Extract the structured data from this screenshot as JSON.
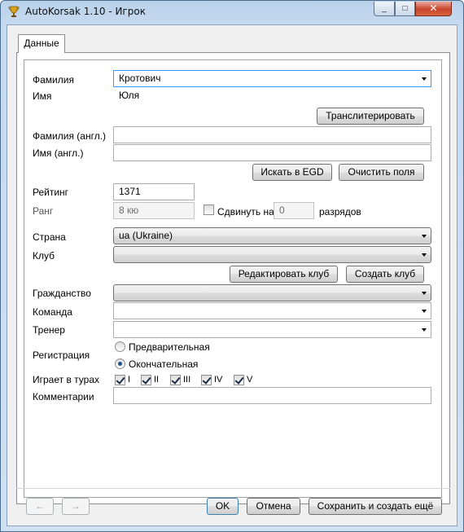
{
  "window": {
    "title": "AutoKorsak 1.10 - Игрок",
    "minimize_glyph": "_",
    "maximize_glyph": "□",
    "close_glyph": "✕",
    "icon": "trophy-icon"
  },
  "tabs": [
    {
      "label": "Данные",
      "active": true
    }
  ],
  "form": {
    "surname": {
      "label": "Фамилия",
      "value": "Кротович"
    },
    "name": {
      "label": "Имя",
      "value": "Юля"
    },
    "transliterate_button": "Транслитерировать",
    "surname_en": {
      "label": "Фамилия (англ.)",
      "value": ""
    },
    "name_en": {
      "label": "Имя (англ.)",
      "value": ""
    },
    "search_egd_button": "Искать в EGD",
    "clear_fields_button": "Очистить поля",
    "rating": {
      "label": "Рейтинг",
      "value": "1371"
    },
    "rank": {
      "label": "Ранг",
      "value": "8 кю"
    },
    "shift": {
      "label": "Сдвинуть на",
      "value": "0",
      "suffix": "разрядов",
      "checked": false
    },
    "country": {
      "label": "Страна",
      "value": "ua (Ukraine)"
    },
    "club": {
      "label": "Клуб",
      "value": ""
    },
    "edit_club_button": "Редактировать клуб",
    "create_club_button": "Создать клуб",
    "citizenship": {
      "label": "Гражданство",
      "value": ""
    },
    "team": {
      "label": "Команда",
      "value": ""
    },
    "coach": {
      "label": "Тренер",
      "value": ""
    },
    "registration": {
      "label": "Регистрация",
      "options": [
        {
          "label": "Предварительная",
          "selected": false
        },
        {
          "label": "Окончательная",
          "selected": true
        }
      ]
    },
    "plays_in_rounds": {
      "label": "Играет в турах",
      "rounds": [
        {
          "label": "I",
          "checked": true
        },
        {
          "label": "II",
          "checked": true
        },
        {
          "label": "III",
          "checked": true
        },
        {
          "label": "IV",
          "checked": true
        },
        {
          "label": "V",
          "checked": true
        }
      ]
    },
    "comments": {
      "label": "Комментарии",
      "value": ""
    }
  },
  "footer": {
    "prev_glyph": "←",
    "next_glyph": "→",
    "ok_button": "OK",
    "cancel_button": "Отмена",
    "save_and_new_button": "Сохранить и создать ещё"
  },
  "colors": {
    "accent_border": "#3399ff",
    "window_frame": "#b9d1ea",
    "close_button": "#c9462c"
  }
}
